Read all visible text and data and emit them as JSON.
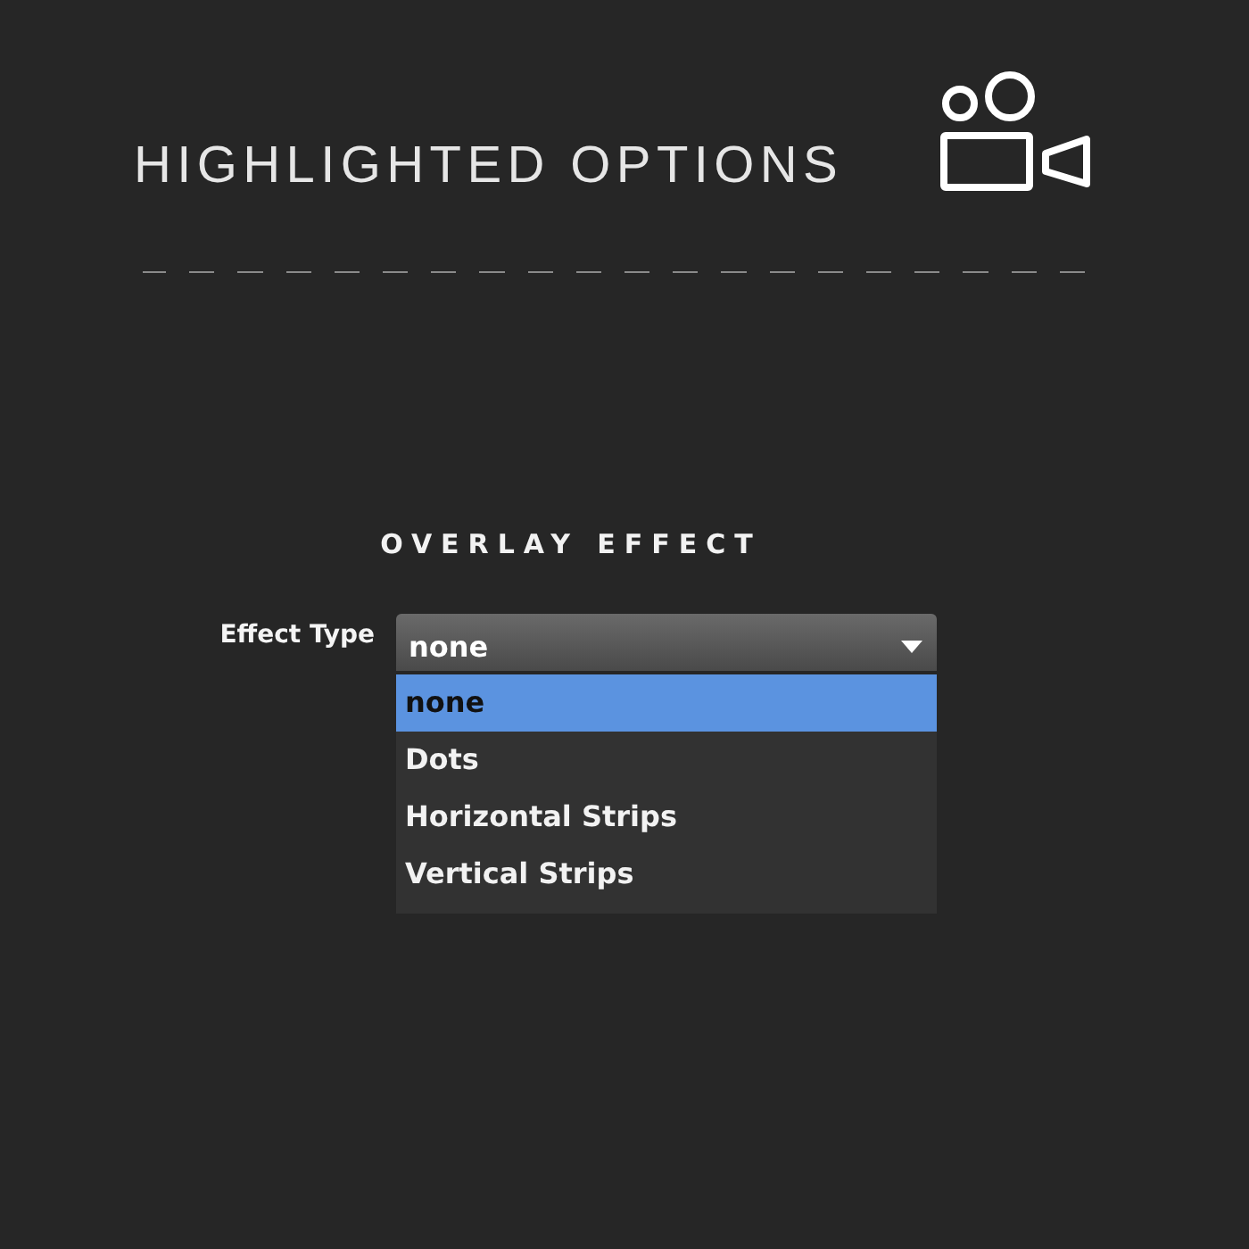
{
  "header": {
    "title": "HIGHLIGHTED OPTIONS"
  },
  "section": {
    "title": "OVERLAY EFFECT"
  },
  "field": {
    "label": "Effect Type",
    "value": "none",
    "expanded": true,
    "options": [
      {
        "label": "none",
        "selected": true
      },
      {
        "label": "Dots",
        "selected": false
      },
      {
        "label": "Horizontal Strips",
        "selected": false
      },
      {
        "label": "Vertical Strips",
        "selected": false
      }
    ]
  }
}
